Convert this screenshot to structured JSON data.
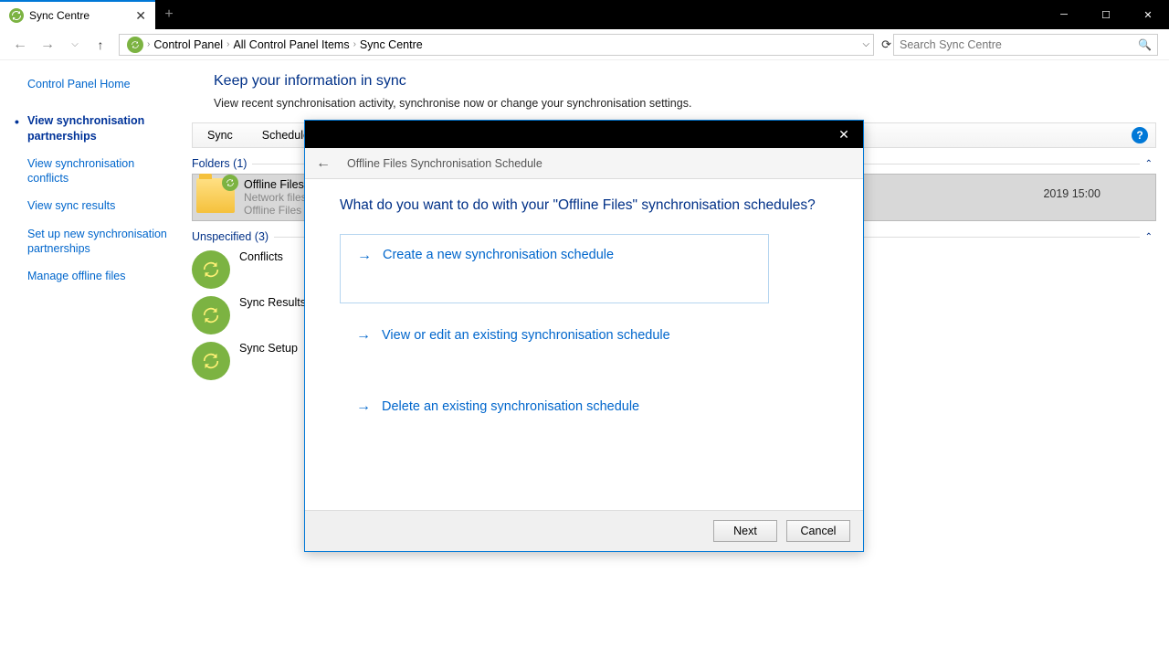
{
  "window": {
    "tab_title": "Sync Centre",
    "add_tab": "+"
  },
  "nav": {
    "breadcrumb": [
      "Control Panel",
      "All Control Panel Items",
      "Sync Centre"
    ],
    "search_placeholder": "Search Sync Centre"
  },
  "sidebar": {
    "home": "Control Panel Home",
    "links": [
      "View synchronisation partnerships",
      "View synchronisation conflicts",
      "View sync results",
      "Set up new synchronisation partnerships",
      "Manage offline files"
    ]
  },
  "main": {
    "title": "Keep your information in sync",
    "desc": "View recent synchronisation activity, synchronise now or change your synchronisation settings.",
    "tabs": {
      "sync": "Sync",
      "schedule": "Schedule"
    },
    "group_folders": "Folders (1)",
    "offline_files": {
      "title": "Offline Files",
      "line2": "Network files",
      "line3": "Offline Files a",
      "meta_right": "2019 15:00"
    },
    "group_unspecified": "Unspecified (3)",
    "items": [
      "Conflicts",
      "Sync Results",
      "Sync Setup"
    ]
  },
  "modal": {
    "subtitle": "Offline Files Synchronisation Schedule",
    "question": "What do you want to do with your \"Offline Files\" synchronisation schedules?",
    "opt_create": "Create a new synchronisation schedule",
    "opt_view": "View or edit an existing synchronisation schedule",
    "opt_delete": "Delete an existing synchronisation schedule",
    "next": "Next",
    "cancel": "Cancel"
  }
}
